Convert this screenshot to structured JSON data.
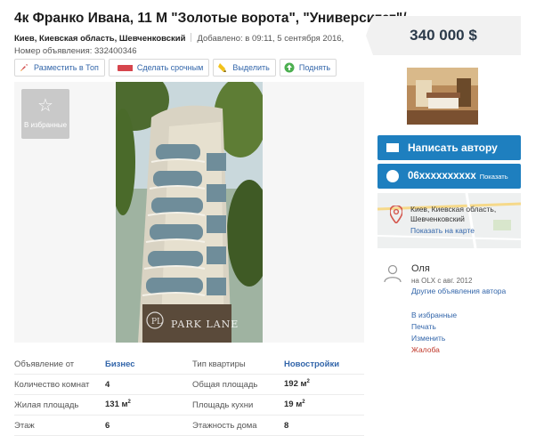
{
  "listing": {
    "title": "4к Франко Ивана, 11 М \"Золотые ворота\", \"Университет\"/",
    "location": "Киев, Киевская область, Шевченковский",
    "added": "Добавлено: в 09:11, 5 сентября 2016,",
    "ad_number": "Номер объявления: 332400346",
    "price": "340 000 $"
  },
  "actions": [
    {
      "label": "Разместить в Топ",
      "icon": "rocket-icon"
    },
    {
      "label": "Сделать срочным",
      "icon": "urgent-badge-icon"
    },
    {
      "label": "Выделить",
      "icon": "highlighter-icon"
    },
    {
      "label": "Поднять",
      "icon": "arrow-up-icon"
    }
  ],
  "gallery": {
    "favorite_label": "В избранные",
    "watermark": "PARK LANE"
  },
  "details": [
    {
      "label": "Объявление от",
      "value": "Бизнес",
      "label2": "Тип квартиры",
      "value2": "Новостройки"
    },
    {
      "label": "Количество комнат",
      "value": "4",
      "label2": "Общая площадь",
      "value2": "192 м"
    },
    {
      "label": "Жилая площадь",
      "value": "131 м",
      "label2": "Площадь кухни",
      "value2": "19 м"
    },
    {
      "label": "Этаж",
      "value": "6",
      "label2": "Этажность дома",
      "value2": "8"
    }
  ],
  "contact": {
    "message_label": "Написать автору",
    "phone_masked": "06xxxxxxxxxx",
    "phone_show": "Показать",
    "map_address": "Киев, Киевская область, Шевченковский",
    "map_link": "Показать на карте"
  },
  "user": {
    "name": "Оля",
    "since": "на OLX с авг. 2012",
    "other_ads": "Другие объявления автора"
  },
  "side_links": {
    "favorite": "В избранные",
    "print": "Печать",
    "edit": "Изменить",
    "report": "Жалоба"
  },
  "colors": {
    "primary_blue": "#1e7fbf",
    "link_blue": "#3366aa",
    "report_red": "#c0392b"
  }
}
